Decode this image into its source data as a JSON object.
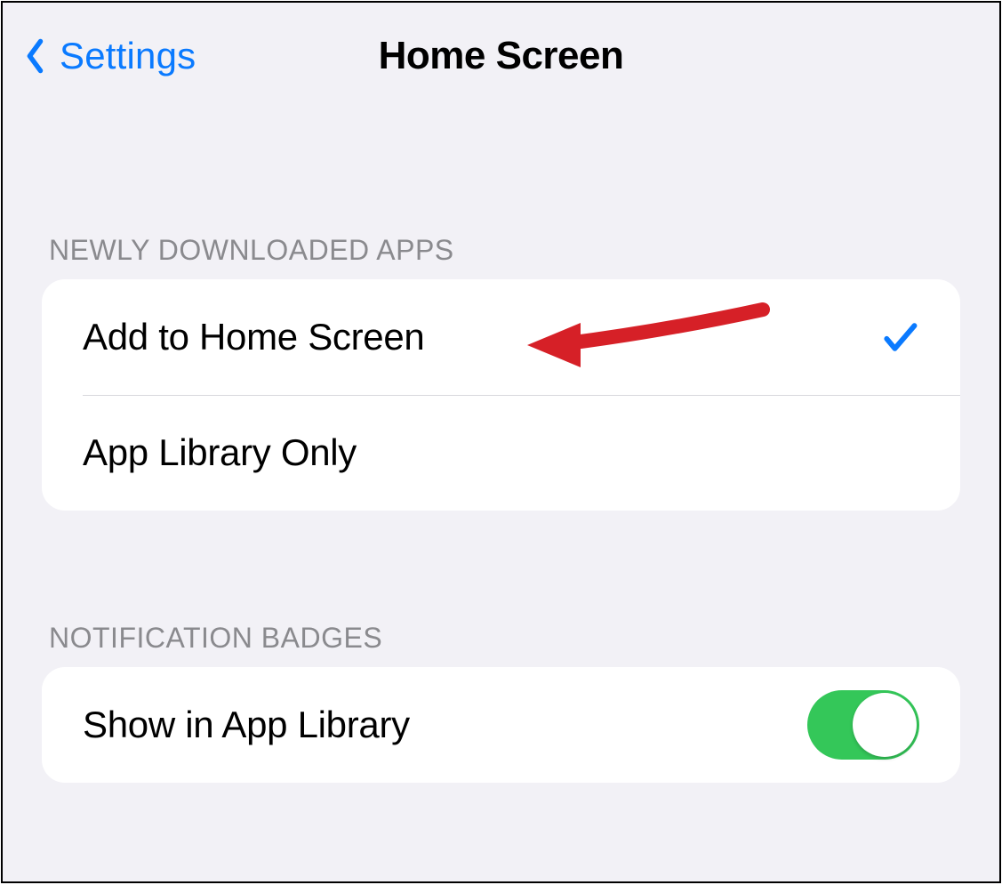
{
  "navbar": {
    "back_label": "Settings",
    "title": "Home Screen"
  },
  "sections": {
    "downloaded": {
      "header": "Newly Downloaded Apps",
      "options": [
        {
          "label": "Add to Home Screen",
          "selected": true
        },
        {
          "label": "App Library Only",
          "selected": false
        }
      ]
    },
    "badges": {
      "header": "Notification Badges",
      "rows": [
        {
          "label": "Show in App Library",
          "toggle_on": true
        }
      ]
    }
  },
  "annotation": {
    "kind": "arrow",
    "color": "#d62027"
  }
}
